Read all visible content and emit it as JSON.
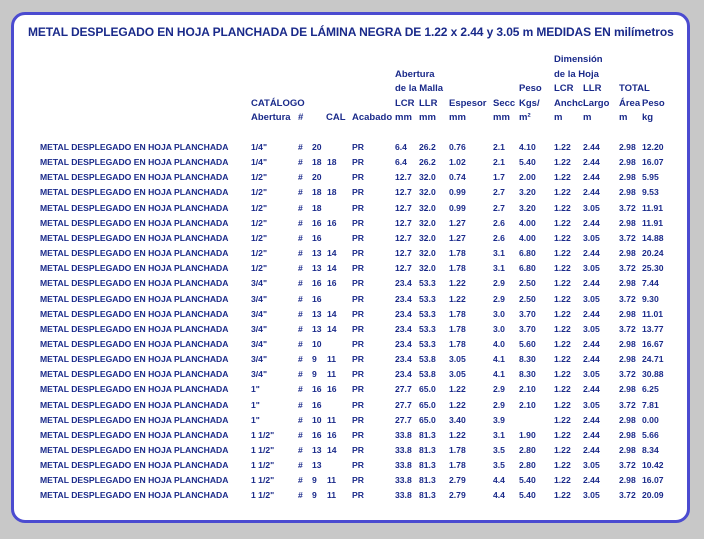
{
  "title": "METAL DESPLEGADO EN HOJA PLANCHADA DE LÁMINA NEGRA DE 1.22 x 2.44 y 3.05 m MEDIDAS EN milímetros",
  "headers": {
    "catalogo": "CATÁLOGO",
    "abertura": "Abertura",
    "num": "#",
    "cal": "CAL",
    "acabado": "Acabado",
    "abertura_malla_1": "Abertura",
    "abertura_malla_2": "de la Malla",
    "lcr": "LCR",
    "llr": "LLR",
    "mm1": "mm",
    "mm2": "mm",
    "espesor": "Espesor",
    "espesor_mm": "mm",
    "secc": "Secc",
    "secc_mm": "mm",
    "peso": "Peso",
    "kgs": "Kgs/",
    "m2": "m²",
    "dimension_1": "Dimensión",
    "dimension_2": "de la Hoja",
    "dim_lcr": "LCR",
    "dim_llr": "LLR",
    "anchc": "Anchc",
    "largo": "Largo",
    "dim_m1": "m",
    "dim_m2": "m",
    "total": "TOTAL",
    "area": "Área",
    "peso_total": "Peso",
    "area_m": "m",
    "kg": "kg"
  },
  "rows": [
    [
      "METAL DESPLEGADO EN HOJA PLANCHADA",
      "1/4\"",
      "#",
      "20",
      "",
      "PR",
      "6.4",
      "26.2",
      "0.76",
      "2.1",
      "4.10",
      "1.22",
      "2.44",
      "2.98",
      "12.20"
    ],
    [
      "METAL DESPLEGADO EN HOJA PLANCHADA",
      "1/4\"",
      "#",
      "18",
      "18",
      "PR",
      "6.4",
      "26.2",
      "1.02",
      "2.1",
      "5.40",
      "1.22",
      "2.44",
      "2.98",
      "16.07"
    ],
    [
      "METAL DESPLEGADO EN HOJA PLANCHADA",
      "1/2\"",
      "#",
      "20",
      "",
      "PR",
      "12.7",
      "32.0",
      "0.74",
      "1.7",
      "2.00",
      "1.22",
      "2.44",
      "2.98",
      "5.95"
    ],
    [
      "METAL DESPLEGADO EN HOJA PLANCHADA",
      "1/2\"",
      "#",
      "18",
      "18",
      "PR",
      "12.7",
      "32.0",
      "0.99",
      "2.7",
      "3.20",
      "1.22",
      "2.44",
      "2.98",
      "9.53"
    ],
    [
      "METAL DESPLEGADO EN HOJA PLANCHADA",
      "1/2\"",
      "#",
      "18",
      "",
      "PR",
      "12.7",
      "32.0",
      "0.99",
      "2.7",
      "3.20",
      "1.22",
      "3.05",
      "3.72",
      "11.91"
    ],
    [
      "METAL DESPLEGADO EN HOJA PLANCHADA",
      "1/2\"",
      "#",
      "16",
      "16",
      "PR",
      "12.7",
      "32.0",
      "1.27",
      "2.6",
      "4.00",
      "1.22",
      "2.44",
      "2.98",
      "11.91"
    ],
    [
      "METAL DESPLEGADO EN HOJA PLANCHADA",
      "1/2\"",
      "#",
      "16",
      "",
      "PR",
      "12.7",
      "32.0",
      "1.27",
      "2.6",
      "4.00",
      "1.22",
      "3.05",
      "3.72",
      "14.88"
    ],
    [
      "METAL DESPLEGADO EN HOJA PLANCHADA",
      "1/2\"",
      "#",
      "13",
      "14",
      "PR",
      "12.7",
      "32.0",
      "1.78",
      "3.1",
      "6.80",
      "1.22",
      "2.44",
      "2.98",
      "20.24"
    ],
    [
      "METAL DESPLEGADO EN HOJA PLANCHADA",
      "1/2\"",
      "#",
      "13",
      "14",
      "PR",
      "12.7",
      "32.0",
      "1.78",
      "3.1",
      "6.80",
      "1.22",
      "3.05",
      "3.72",
      "25.30"
    ],
    [
      "METAL DESPLEGADO EN HOJA PLANCHADA",
      "3/4\"",
      "#",
      "16",
      "16",
      "PR",
      "23.4",
      "53.3",
      "1.22",
      "2.9",
      "2.50",
      "1.22",
      "2.44",
      "2.98",
      "7.44"
    ],
    [
      "METAL DESPLEGADO EN HOJA PLANCHADA",
      "3/4\"",
      "#",
      "16",
      "",
      "PR",
      "23.4",
      "53.3",
      "1.22",
      "2.9",
      "2.50",
      "1.22",
      "3.05",
      "3.72",
      "9.30"
    ],
    [
      "METAL DESPLEGADO EN HOJA PLANCHADA",
      "3/4\"",
      "#",
      "13",
      "14",
      "PR",
      "23.4",
      "53.3",
      "1.78",
      "3.0",
      "3.70",
      "1.22",
      "2.44",
      "2.98",
      "11.01"
    ],
    [
      "METAL DESPLEGADO EN HOJA PLANCHADA",
      "3/4\"",
      "#",
      "13",
      "14",
      "PR",
      "23.4",
      "53.3",
      "1.78",
      "3.0",
      "3.70",
      "1.22",
      "3.05",
      "3.72",
      "13.77"
    ],
    [
      "METAL DESPLEGADO EN HOJA PLANCHADA",
      "3/4\"",
      "#",
      "10",
      "",
      "PR",
      "23.4",
      "53.3",
      "1.78",
      "4.0",
      "5.60",
      "1.22",
      "2.44",
      "2.98",
      "16.67"
    ],
    [
      "METAL DESPLEGADO EN HOJA PLANCHADA",
      "3/4\"",
      "#",
      "9",
      "11",
      "PR",
      "23.4",
      "53.8",
      "3.05",
      "4.1",
      "8.30",
      "1.22",
      "2.44",
      "2.98",
      "24.71"
    ],
    [
      "METAL DESPLEGADO EN HOJA PLANCHADA",
      "3/4\"",
      "#",
      "9",
      "11",
      "PR",
      "23.4",
      "53.8",
      "3.05",
      "4.1",
      "8.30",
      "1.22",
      "3.05",
      "3.72",
      "30.88"
    ],
    [
      "METAL DESPLEGADO EN HOJA PLANCHADA",
      "1\"",
      "#",
      "16",
      "16",
      "PR",
      "27.7",
      "65.0",
      "1.22",
      "2.9",
      "2.10",
      "1.22",
      "2.44",
      "2.98",
      "6.25"
    ],
    [
      "METAL DESPLEGADO EN HOJA PLANCHADA",
      "1\"",
      "#",
      "16",
      "",
      "PR",
      "27.7",
      "65.0",
      "1.22",
      "2.9",
      "2.10",
      "1.22",
      "3.05",
      "3.72",
      "7.81"
    ],
    [
      "METAL DESPLEGADO EN HOJA PLANCHADA",
      "1\"",
      "#",
      "10",
      "11",
      "PR",
      "27.7",
      "65.0",
      "3.40",
      "3.9",
      "",
      "1.22",
      "2.44",
      "2.98",
      "0.00"
    ],
    [
      "METAL DESPLEGADO EN HOJA PLANCHADA",
      "1 1/2\"",
      "#",
      "16",
      "16",
      "PR",
      "33.8",
      "81.3",
      "1.22",
      "3.1",
      "1.90",
      "1.22",
      "2.44",
      "2.98",
      "5.66"
    ],
    [
      "METAL DESPLEGADO EN HOJA PLANCHADA",
      "1 1/2\"",
      "#",
      "13",
      "14",
      "PR",
      "33.8",
      "81.3",
      "1.78",
      "3.5",
      "2.80",
      "1.22",
      "2.44",
      "2.98",
      "8.34"
    ],
    [
      "METAL DESPLEGADO EN HOJA PLANCHADA",
      "1 1/2\"",
      "#",
      "13",
      "",
      "PR",
      "33.8",
      "81.3",
      "1.78",
      "3.5",
      "2.80",
      "1.22",
      "3.05",
      "3.72",
      "10.42"
    ],
    [
      "METAL DESPLEGADO EN HOJA PLANCHADA",
      "1 1/2\"",
      "#",
      "9",
      "11",
      "PR",
      "33.8",
      "81.3",
      "2.79",
      "4.4",
      "5.40",
      "1.22",
      "2.44",
      "2.98",
      "16.07"
    ],
    [
      "METAL DESPLEGADO EN HOJA PLANCHADA",
      "1 1/2\"",
      "#",
      "9",
      "11",
      "PR",
      "33.8",
      "81.3",
      "2.79",
      "4.4",
      "5.40",
      "1.22",
      "3.05",
      "3.72",
      "20.09"
    ]
  ]
}
